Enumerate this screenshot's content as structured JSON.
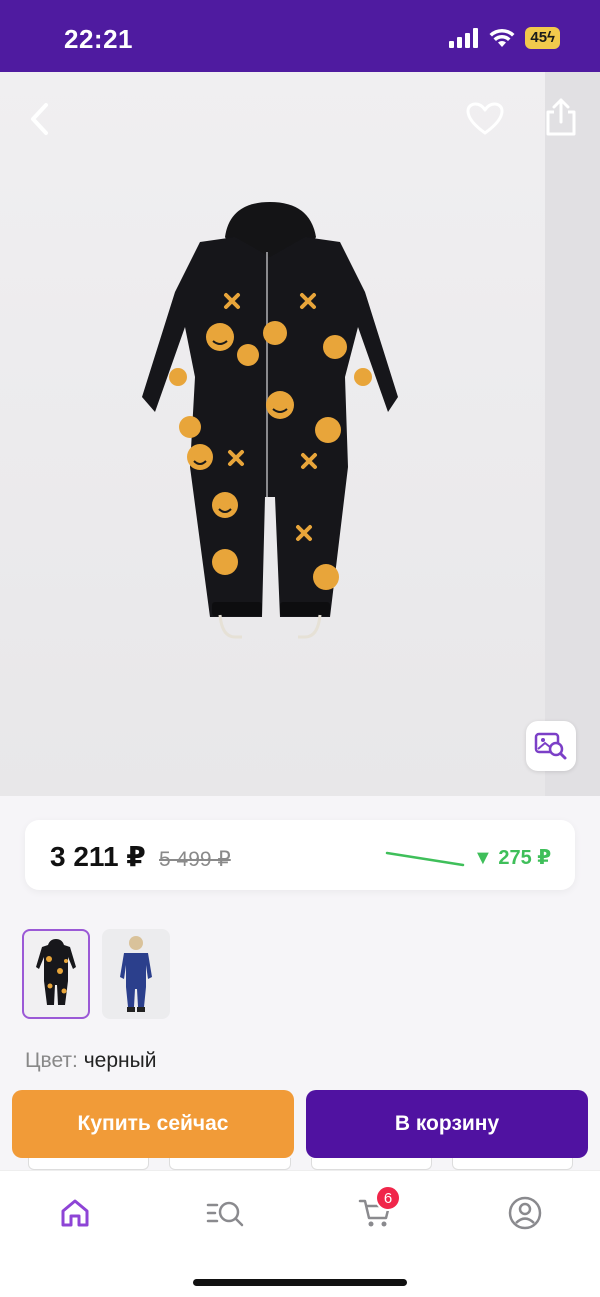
{
  "status_bar": {
    "time": "22:21",
    "battery": "45",
    "colors": {
      "background": "#4f1ba0"
    }
  },
  "product_photo": {
    "icons": [
      "back-arrow-icon",
      "heart-icon",
      "share-icon",
      "visual-search-icon"
    ]
  },
  "price": {
    "current": "3 211 ₽",
    "old": "5 499 ₽",
    "drop": "▼ 275 ₽",
    "colors": {
      "drop": "#3fbf5a",
      "trend_line": "#3fbf5a"
    }
  },
  "thumbnails": [
    {
      "name": "black-jumpsuit",
      "selected": true
    },
    {
      "name": "blue-jumpsuit-on-child",
      "selected": false
    }
  ],
  "color": {
    "label": "Цвет:",
    "value": "черный"
  },
  "actions": {
    "buy_now": "Купить сейчас",
    "add_to_cart": "В корзину",
    "colors": {
      "buy_now": "#f19b38",
      "add_to_cart": "#5012a1"
    }
  },
  "bottom_nav": {
    "items": [
      "home-icon",
      "catalog-search-icon",
      "cart-icon",
      "profile-icon"
    ],
    "cart_count": "6",
    "active": "home"
  }
}
